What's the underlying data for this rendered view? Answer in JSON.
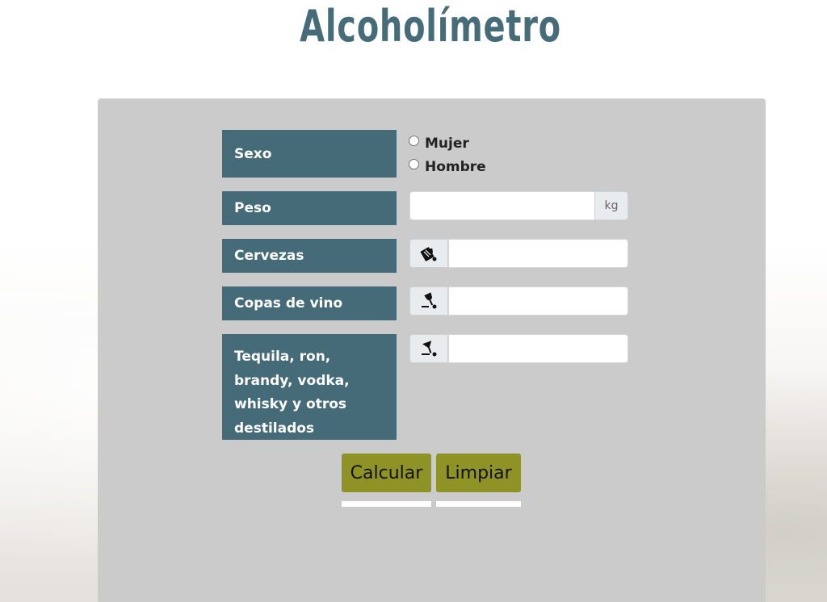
{
  "header": {
    "title": "Alcoholímetro"
  },
  "form": {
    "sexo": {
      "label": "Sexo",
      "options": [
        "Mujer",
        "Hombre"
      ]
    },
    "peso": {
      "label": "Peso",
      "value": "",
      "unit": "kg"
    },
    "cervezas": {
      "label": "Cervezas",
      "value": "",
      "icon": "beer-mug-icon"
    },
    "vino": {
      "label": "Copas de vino",
      "value": "",
      "icon": "wine-glass-icon"
    },
    "destilados": {
      "label": "Tequila, ron, brandy, vodka, whisky y otros destilados",
      "value": "",
      "icon": "cocktail-glass-icon"
    }
  },
  "buttons": {
    "calcular": "Calcular",
    "limpiar": "Limpiar"
  },
  "colors": {
    "title": "#456c78",
    "label_bg": "#456a78",
    "panel_bg": "#cbcbcb",
    "button_bg": "#8f9225"
  }
}
